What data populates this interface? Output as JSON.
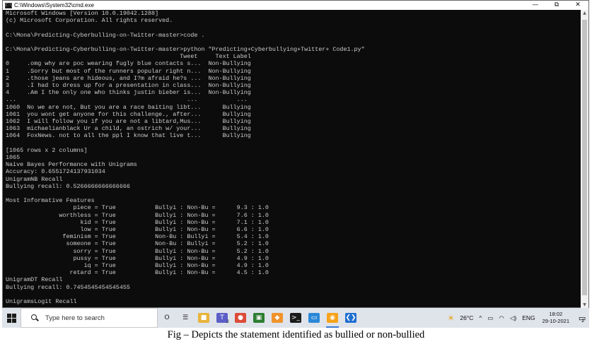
{
  "window": {
    "title": "C:\\Windows\\System32\\cmd.exe",
    "controls": [
      "—",
      "⧉",
      "✕"
    ]
  },
  "console_lines": [
    "Microsoft Windows [Version 10.0.19042.1288]",
    "(c) Microsoft Corporation. All rights reserved.",
    "",
    "C:\\Mona\\Predicting-Cyberbulling-on-Twitter-master>code .",
    "",
    "C:\\Mona\\Predicting-Cyberbulling-on-Twitter-master>python \"Predicting+Cyberbullying+Twitter+ Code1.py\"",
    "                                                 Tweet     Text Label",
    "0     .omg why are poc wearing fugly blue contacts s...  Non-Bullying",
    "1     .Sorry but most of the runners popular right n...  Non-Bullying",
    "2     .those jeans are hideous, and I?m afraid he?s ...  Non-Bullying",
    "3     .I had to dress up for a presentation in class...  Non-Bullying",
    "4     .Am I the only one who thinks justin bieber is...  Non-Bullying",
    "...                                                ...           ...",
    "1060  No we are not, But you are a race baiting libt...      Bullying",
    "1061  you wont get anyone for this challenge., after...      Bullying",
    "1062  I will follow you if you are not a libtard,Mus...      Bullying",
    "1063  michaelianblack Ur a child, an ostrich w/ your...      Bullying",
    "1064  FoxNews. not to all the ppl I know that live t...      Bullying",
    "",
    "[1065 rows x 2 columns]",
    "1065",
    "Naive Bayes Performance with Unigrams",
    "Accuracy: 0.6551724137931034",
    "UnigramNB Recall",
    "Bullying recall: 0.5266666666666666",
    "",
    "Most Informative Features",
    "                   piece = True           Bullyi : Non-Bu =      9.3 : 1.0",
    "               worthless = True           Bullyi : Non-Bu =      7.6 : 1.0",
    "                     kid = True           Bullyi : Non-Bu =      7.1 : 1.0",
    "                     low = True           Bullyi : Non-Bu =      6.6 : 1.0",
    "                feminism = True           Non-Bu : Bullyi =      5.4 : 1.0",
    "                 someone = True           Non-Bu : Bullyi =      5.2 : 1.0",
    "                   sorry = True           Bullyi : Non-Bu =      5.2 : 1.0",
    "                   pussy = True           Bullyi : Non-Bu =      4.9 : 1.0",
    "                      iq = True           Bullyi : Non-Bu =      4.9 : 1.0",
    "                  retard = True           Bullyi : Non-Bu =      4.5 : 1.0",
    "UnigramDT Recall",
    "Bullying recall: 0.7454545454545455",
    "",
    "UnigramsLogit Recall"
  ],
  "taskbar": {
    "search_placeholder": "Type here to search",
    "apps": [
      {
        "icon": "cortana-icon",
        "glyph": "O",
        "color": "#1a1a1a"
      },
      {
        "icon": "task-view-icon",
        "glyph": "☰",
        "color": "#1a1a1a"
      },
      {
        "icon": "file-explorer-icon",
        "glyph": "■",
        "color": "#e8b43a"
      },
      {
        "icon": "teams-icon",
        "glyph": "T",
        "color": "#5b5fc7",
        "badge": "2"
      },
      {
        "icon": "chrome-icon",
        "glyph": "●",
        "color": "#dd4b39"
      },
      {
        "icon": "photos-icon",
        "glyph": "▣",
        "color": "#2e7d32"
      },
      {
        "icon": "app-icon",
        "glyph": "◆",
        "color": "#f0932b"
      },
      {
        "icon": "terminal-icon",
        "glyph": ">_",
        "color": "#1a1a1a"
      },
      {
        "icon": "monitor-icon",
        "glyph": "▭",
        "color": "#2b88d8"
      },
      {
        "icon": "settings-app-icon",
        "glyph": "◉",
        "color": "#f6a31a",
        "active": true
      },
      {
        "icon": "vscode-icon",
        "glyph": "❮❯",
        "color": "#1f6fd1"
      }
    ],
    "weather": "26°C",
    "language": "ENG",
    "time": "18:02",
    "date": "29-10-2021",
    "notification_count": "2"
  },
  "caption": "Fig – Depicts the statement identified as bullied or non-bullied"
}
